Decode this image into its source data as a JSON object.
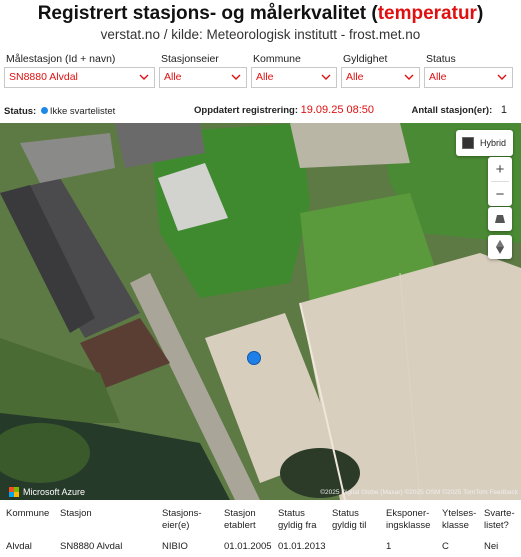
{
  "header": {
    "title_main": "Registrert stasjons- og målerkvalitet",
    "title_accent": "temperatur",
    "subtitle": "verstat.no / kilde: Meteorologisk institutt - frost.met.no"
  },
  "filters": [
    {
      "label": "Målestasjon (Id + navn)",
      "value": "SN8880 Alvdal"
    },
    {
      "label": "Stasjonseier",
      "value": "Alle"
    },
    {
      "label": "Kommune",
      "value": "Alle"
    },
    {
      "label": "Gyldighet",
      "value": "Alle"
    },
    {
      "label": "Status",
      "value": "Alle"
    }
  ],
  "status": {
    "label": "Status:",
    "legend_text": "Ikke svartelistet",
    "updated_label": "Oppdatert registrering:",
    "updated_value": "19.09.25 08:50",
    "count_label": "Antall stasjon(er):",
    "count_value": "1"
  },
  "map": {
    "hybrid_label": "Hybrid",
    "zoom_in": "+",
    "zoom_out": "−",
    "provider": "Microsoft Azure",
    "attribution": "©2025 Digital Globe (Maxar) ©2025 OSM ©2025 TomTom Feedback",
    "colors": {
      "marker": "#1e7fe8"
    }
  },
  "table": {
    "headers": [
      "Kommune",
      "Stasjon",
      "Stasjons-eier(e)",
      "Stasjon etablert",
      "Status gyldig fra",
      "Status gyldig til",
      "Eksponer-ingsklasse",
      "Ytelses-klasse",
      "Svarte-listet?"
    ],
    "rows": [
      [
        "Alvdal",
        "SN8880 Alvdal",
        "NIBIO",
        "01.01.2005",
        "01.01.2013",
        "",
        "1",
        "C",
        "Nei"
      ]
    ]
  },
  "colors": {
    "accent": "#e01010",
    "status_dot": "#1e88e5"
  }
}
